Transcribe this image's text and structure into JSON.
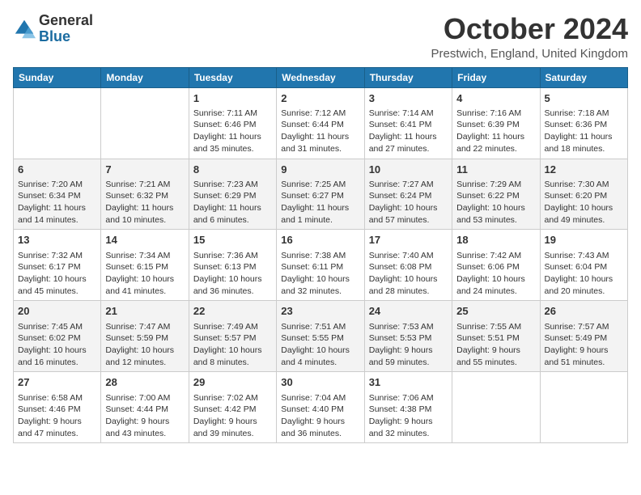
{
  "header": {
    "logo_line1": "General",
    "logo_line2": "Blue",
    "month": "October 2024",
    "location": "Prestwich, England, United Kingdom"
  },
  "weekdays": [
    "Sunday",
    "Monday",
    "Tuesday",
    "Wednesday",
    "Thursday",
    "Friday",
    "Saturday"
  ],
  "weeks": [
    [
      {
        "day": "",
        "info": ""
      },
      {
        "day": "",
        "info": ""
      },
      {
        "day": "1",
        "info": "Sunrise: 7:11 AM\nSunset: 6:46 PM\nDaylight: 11 hours and 35 minutes."
      },
      {
        "day": "2",
        "info": "Sunrise: 7:12 AM\nSunset: 6:44 PM\nDaylight: 11 hours and 31 minutes."
      },
      {
        "day": "3",
        "info": "Sunrise: 7:14 AM\nSunset: 6:41 PM\nDaylight: 11 hours and 27 minutes."
      },
      {
        "day": "4",
        "info": "Sunrise: 7:16 AM\nSunset: 6:39 PM\nDaylight: 11 hours and 22 minutes."
      },
      {
        "day": "5",
        "info": "Sunrise: 7:18 AM\nSunset: 6:36 PM\nDaylight: 11 hours and 18 minutes."
      }
    ],
    [
      {
        "day": "6",
        "info": "Sunrise: 7:20 AM\nSunset: 6:34 PM\nDaylight: 11 hours and 14 minutes."
      },
      {
        "day": "7",
        "info": "Sunrise: 7:21 AM\nSunset: 6:32 PM\nDaylight: 11 hours and 10 minutes."
      },
      {
        "day": "8",
        "info": "Sunrise: 7:23 AM\nSunset: 6:29 PM\nDaylight: 11 hours and 6 minutes."
      },
      {
        "day": "9",
        "info": "Sunrise: 7:25 AM\nSunset: 6:27 PM\nDaylight: 11 hours and 1 minute."
      },
      {
        "day": "10",
        "info": "Sunrise: 7:27 AM\nSunset: 6:24 PM\nDaylight: 10 hours and 57 minutes."
      },
      {
        "day": "11",
        "info": "Sunrise: 7:29 AM\nSunset: 6:22 PM\nDaylight: 10 hours and 53 minutes."
      },
      {
        "day": "12",
        "info": "Sunrise: 7:30 AM\nSunset: 6:20 PM\nDaylight: 10 hours and 49 minutes."
      }
    ],
    [
      {
        "day": "13",
        "info": "Sunrise: 7:32 AM\nSunset: 6:17 PM\nDaylight: 10 hours and 45 minutes."
      },
      {
        "day": "14",
        "info": "Sunrise: 7:34 AM\nSunset: 6:15 PM\nDaylight: 10 hours and 41 minutes."
      },
      {
        "day": "15",
        "info": "Sunrise: 7:36 AM\nSunset: 6:13 PM\nDaylight: 10 hours and 36 minutes."
      },
      {
        "day": "16",
        "info": "Sunrise: 7:38 AM\nSunset: 6:11 PM\nDaylight: 10 hours and 32 minutes."
      },
      {
        "day": "17",
        "info": "Sunrise: 7:40 AM\nSunset: 6:08 PM\nDaylight: 10 hours and 28 minutes."
      },
      {
        "day": "18",
        "info": "Sunrise: 7:42 AM\nSunset: 6:06 PM\nDaylight: 10 hours and 24 minutes."
      },
      {
        "day": "19",
        "info": "Sunrise: 7:43 AM\nSunset: 6:04 PM\nDaylight: 10 hours and 20 minutes."
      }
    ],
    [
      {
        "day": "20",
        "info": "Sunrise: 7:45 AM\nSunset: 6:02 PM\nDaylight: 10 hours and 16 minutes."
      },
      {
        "day": "21",
        "info": "Sunrise: 7:47 AM\nSunset: 5:59 PM\nDaylight: 10 hours and 12 minutes."
      },
      {
        "day": "22",
        "info": "Sunrise: 7:49 AM\nSunset: 5:57 PM\nDaylight: 10 hours and 8 minutes."
      },
      {
        "day": "23",
        "info": "Sunrise: 7:51 AM\nSunset: 5:55 PM\nDaylight: 10 hours and 4 minutes."
      },
      {
        "day": "24",
        "info": "Sunrise: 7:53 AM\nSunset: 5:53 PM\nDaylight: 9 hours and 59 minutes."
      },
      {
        "day": "25",
        "info": "Sunrise: 7:55 AM\nSunset: 5:51 PM\nDaylight: 9 hours and 55 minutes."
      },
      {
        "day": "26",
        "info": "Sunrise: 7:57 AM\nSunset: 5:49 PM\nDaylight: 9 hours and 51 minutes."
      }
    ],
    [
      {
        "day": "27",
        "info": "Sunrise: 6:58 AM\nSunset: 4:46 PM\nDaylight: 9 hours and 47 minutes."
      },
      {
        "day": "28",
        "info": "Sunrise: 7:00 AM\nSunset: 4:44 PM\nDaylight: 9 hours and 43 minutes."
      },
      {
        "day": "29",
        "info": "Sunrise: 7:02 AM\nSunset: 4:42 PM\nDaylight: 9 hours and 39 minutes."
      },
      {
        "day": "30",
        "info": "Sunrise: 7:04 AM\nSunset: 4:40 PM\nDaylight: 9 hours and 36 minutes."
      },
      {
        "day": "31",
        "info": "Sunrise: 7:06 AM\nSunset: 4:38 PM\nDaylight: 9 hours and 32 minutes."
      },
      {
        "day": "",
        "info": ""
      },
      {
        "day": "",
        "info": ""
      }
    ]
  ]
}
